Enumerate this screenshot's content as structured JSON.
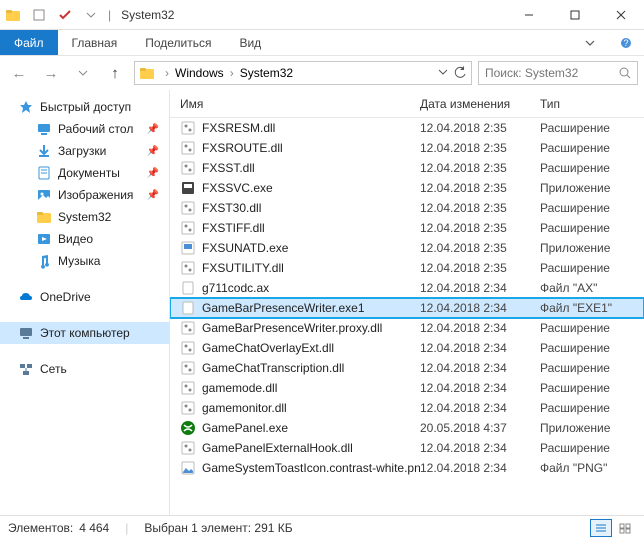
{
  "titlebar": {
    "title": "System32"
  },
  "ribbon": {
    "file": "Файл",
    "tabs": [
      "Главная",
      "Поделиться",
      "Вид"
    ]
  },
  "address": {
    "crumbs": [
      "Windows",
      "System32"
    ],
    "search_placeholder": "Поиск: System32"
  },
  "sidebar": {
    "quick": "Быстрый доступ",
    "items": [
      {
        "label": "Рабочий стол",
        "icon": "desktop",
        "pinned": true
      },
      {
        "label": "Загрузки",
        "icon": "downloads",
        "pinned": true
      },
      {
        "label": "Документы",
        "icon": "documents",
        "pinned": true
      },
      {
        "label": "Изображения",
        "icon": "pictures",
        "pinned": true
      },
      {
        "label": "System32",
        "icon": "folder",
        "pinned": false
      },
      {
        "label": "Видео",
        "icon": "videos",
        "pinned": false
      },
      {
        "label": "Музыка",
        "icon": "music",
        "pinned": false
      }
    ],
    "onedrive": "OneDrive",
    "thispc": "Этот компьютер",
    "network": "Сеть"
  },
  "columns": {
    "name": "Имя",
    "date": "Дата изменения",
    "type": "Тип"
  },
  "files": [
    {
      "name": "FXSRESM.dll",
      "icon": "dll",
      "date": "12.04.2018 2:35",
      "type": "Расширение"
    },
    {
      "name": "FXSROUTE.dll",
      "icon": "dll",
      "date": "12.04.2018 2:35",
      "type": "Расширение"
    },
    {
      "name": "FXSST.dll",
      "icon": "dll",
      "date": "12.04.2018 2:35",
      "type": "Расширение"
    },
    {
      "name": "FXSSVC.exe",
      "icon": "exe-fax",
      "date": "12.04.2018 2:35",
      "type": "Приложение"
    },
    {
      "name": "FXST30.dll",
      "icon": "dll",
      "date": "12.04.2018 2:35",
      "type": "Расширение"
    },
    {
      "name": "FXSTIFF.dll",
      "icon": "dll",
      "date": "12.04.2018 2:35",
      "type": "Расширение"
    },
    {
      "name": "FXSUNATD.exe",
      "icon": "exe",
      "date": "12.04.2018 2:35",
      "type": "Приложение"
    },
    {
      "name": "FXSUTILITY.dll",
      "icon": "dll",
      "date": "12.04.2018 2:35",
      "type": "Расширение"
    },
    {
      "name": "g711codc.ax",
      "icon": "file",
      "date": "12.04.2018 2:34",
      "type": "Файл \"AX\""
    },
    {
      "name": "GameBarPresenceWriter.exe1",
      "icon": "file",
      "date": "12.04.2018 2:34",
      "type": "Файл \"EXE1\"",
      "selected": true
    },
    {
      "name": "GameBarPresenceWriter.proxy.dll",
      "icon": "dll",
      "date": "12.04.2018 2:34",
      "type": "Расширение"
    },
    {
      "name": "GameChatOverlayExt.dll",
      "icon": "dll",
      "date": "12.04.2018 2:34",
      "type": "Расширение"
    },
    {
      "name": "GameChatTranscription.dll",
      "icon": "dll",
      "date": "12.04.2018 2:34",
      "type": "Расширение"
    },
    {
      "name": "gamemode.dll",
      "icon": "dll",
      "date": "12.04.2018 2:34",
      "type": "Расширение"
    },
    {
      "name": "gamemonitor.dll",
      "icon": "dll",
      "date": "12.04.2018 2:34",
      "type": "Расширение"
    },
    {
      "name": "GamePanel.exe",
      "icon": "xbox",
      "date": "20.05.2018 4:37",
      "type": "Приложение"
    },
    {
      "name": "GamePanelExternalHook.dll",
      "icon": "dll",
      "date": "12.04.2018 2:34",
      "type": "Расширение"
    },
    {
      "name": "GameSystemToastIcon.contrast-white.png",
      "icon": "png",
      "date": "12.04.2018 2:34",
      "type": "Файл \"PNG\""
    }
  ],
  "status": {
    "count_label": "Элементов:",
    "count": "4 464",
    "selection": "Выбран 1 элемент: 291 КБ"
  }
}
